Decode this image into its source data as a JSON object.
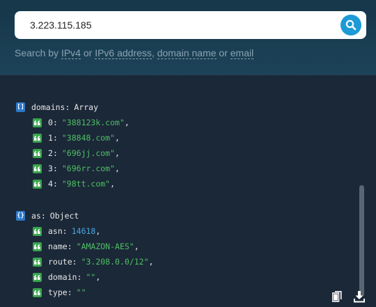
{
  "search": {
    "value": "3.223.115.185",
    "hint_prefix": "Search by",
    "hint_ipv4": "IPv4",
    "hint_or1": "or",
    "hint_ipv6": "IPv6 address",
    "hint_sep": ",",
    "hint_domain": "domain name",
    "hint_or2": "or",
    "hint_email": "email"
  },
  "result": {
    "domains": {
      "key": "domains",
      "type": "Array",
      "items": [
        {
          "index": "0",
          "value": "\"388123k.com\""
        },
        {
          "index": "1",
          "value": "\"38848.com\""
        },
        {
          "index": "2",
          "value": "\"696jj.com\""
        },
        {
          "index": "3",
          "value": "\"696rr.com\""
        },
        {
          "index": "4",
          "value": "\"98tt.com\""
        }
      ]
    },
    "as": {
      "key": "as",
      "type": "Object",
      "fields": [
        {
          "key": "asn",
          "value": "14618",
          "kind": "number"
        },
        {
          "key": "name",
          "value": "\"AMAZON-AES\"",
          "kind": "string"
        },
        {
          "key": "route",
          "value": "\"3.208.0.0/12\"",
          "kind": "string"
        },
        {
          "key": "domain",
          "value": "\"\"",
          "kind": "string"
        },
        {
          "key": "type",
          "value": "\"\"",
          "kind": "string"
        }
      ]
    }
  },
  "icons": {
    "search": "search-icon",
    "array": "array-icon",
    "object": "object-icon",
    "string": "quote-icon",
    "copy": "copy-icon",
    "download": "download-icon"
  },
  "colors": {
    "accent": "#1e9ad6",
    "string": "#4fbf62",
    "number": "#4aa7e0",
    "badge_array": "#2b78c8",
    "badge_value": "#3aa54d",
    "background": "#1b2838"
  }
}
